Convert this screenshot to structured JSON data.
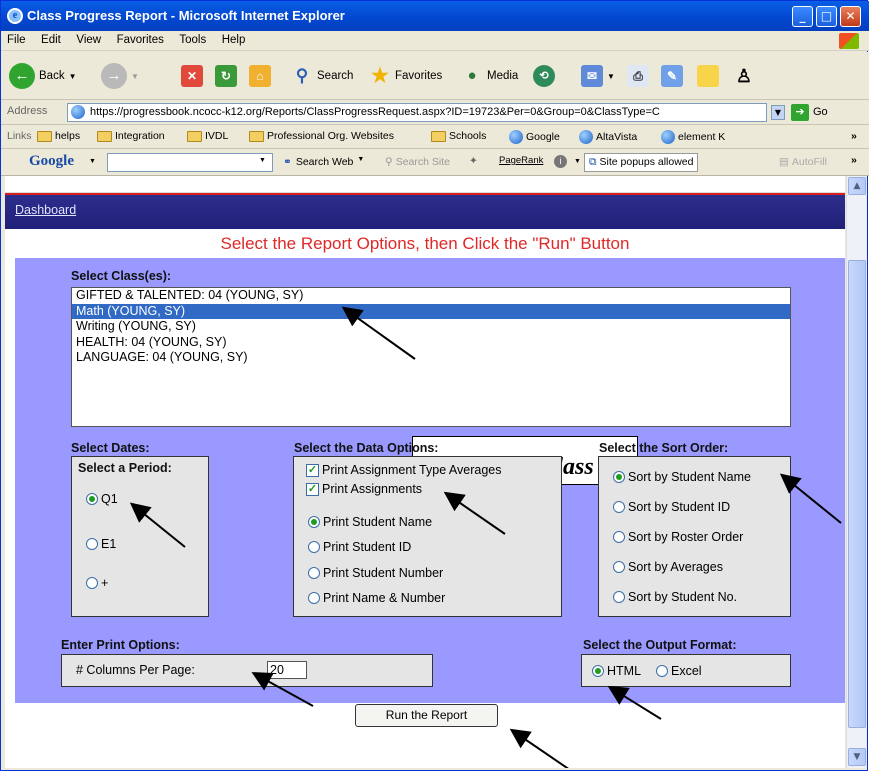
{
  "window": {
    "title": "Class Progress Report - Microsoft Internet Explorer"
  },
  "menu": [
    "File",
    "Edit",
    "View",
    "Favorites",
    "Tools",
    "Help"
  ],
  "toolbar": {
    "back": "Back",
    "search": "Search",
    "favorites": "Favorites",
    "media": "Media"
  },
  "address": {
    "label": "Address",
    "url": "https://progressbook.ncocc-k12.org/Reports/ClassProgressRequest.aspx?ID=19723&Per=0&Group=0&ClassType=C",
    "go": "Go"
  },
  "links": {
    "label": "Links",
    "items": [
      "helps",
      "Integration",
      "IVDL",
      "Professional Org. Websites",
      "Schools",
      "Google",
      "AltaVista",
      "element K"
    ]
  },
  "googlebar": {
    "logo": "Google",
    "search_web": "Search Web",
    "search_site": "Search Site",
    "pagerank": "PageRank",
    "popups": "Site popups allowed",
    "autofill": "AutoFill"
  },
  "nav": {
    "dashboard": "Dashboard"
  },
  "page": {
    "heading": "Select the Report Options, then Click the \"Run\" Button",
    "select_classes_label": "Select Class(es):",
    "classes": [
      {
        "label": "GIFTED & TALENTED: 04 (YOUNG, SY)",
        "selected": false
      },
      {
        "label": "Math (YOUNG, SY)",
        "selected": true
      },
      {
        "label": "Writing (YOUNG, SY)",
        "selected": false
      },
      {
        "label": "HEALTH: 04 (YOUNG, SY)",
        "selected": false
      },
      {
        "label": "LANGUAGE: 04 (YOUNG, SY)",
        "selected": false
      }
    ],
    "callout": "Click on class",
    "dates": {
      "label": "Select Dates:",
      "period_label": "Select a Period:",
      "periods": [
        "Q1",
        "E1",
        "+"
      ]
    },
    "data_options": {
      "label": "Select the Data Options:",
      "checkboxes": [
        "Print Assignment Type Averages",
        "Print Assignments"
      ],
      "radios": [
        "Print Student Name",
        "Print Student ID",
        "Print Student Number",
        "Print Name & Number"
      ]
    },
    "sort": {
      "label": "Select the Sort Order:",
      "options": [
        "Sort by Student Name",
        "Sort by Student ID",
        "Sort by Roster Order",
        "Sort by Averages",
        "Sort by Student No."
      ]
    },
    "print_options": {
      "label": "Enter Print Options:",
      "columns_label": "# Columns Per Page:",
      "columns_value": "20"
    },
    "output": {
      "label": "Select the Output Format:",
      "options": [
        "HTML",
        "Excel"
      ]
    },
    "run_button": "Run the Report"
  }
}
